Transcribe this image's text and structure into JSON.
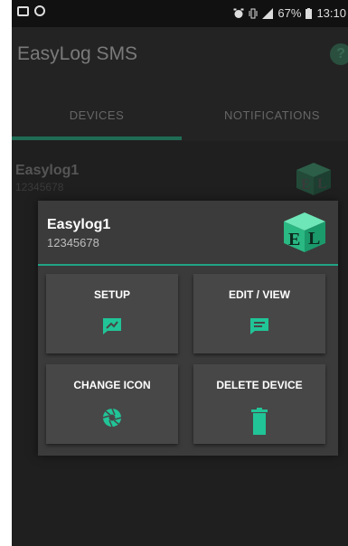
{
  "status_bar": {
    "battery": "67%",
    "time": "13:10",
    "icons": [
      "image-icon",
      "sync-icon",
      "alarm-icon",
      "vibrate-icon",
      "signal-icon",
      "battery-icon"
    ]
  },
  "app_bar": {
    "title": "EasyLog SMS",
    "help_icon": "help-icon"
  },
  "tabs": [
    {
      "label": "DEVICES",
      "active": true
    },
    {
      "label": "NOTIFICATIONS",
      "active": false
    }
  ],
  "device_list": [
    {
      "name": "Easylog1",
      "serial": "12345678",
      "icon": "el-cube-logo"
    }
  ],
  "dialog": {
    "device_name": "Easylog1",
    "device_serial": "12345678",
    "device_icon": "el-cube-logo",
    "actions": [
      {
        "label": "SETUP",
        "icon": "setup-chat-icon"
      },
      {
        "label": "EDIT / VIEW",
        "icon": "edit-chat-icon"
      },
      {
        "label": "CHANGE ICON",
        "icon": "aperture-icon"
      },
      {
        "label": "DELETE DEVICE",
        "icon": "trash-icon"
      }
    ]
  },
  "colors": {
    "accent": "#21a486",
    "background": "#1f1f1f",
    "dialog": "#3b3b3b",
    "tile": "#474747"
  }
}
